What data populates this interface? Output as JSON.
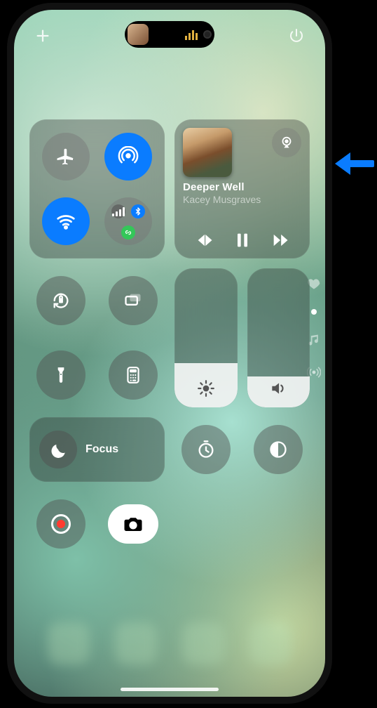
{
  "statusbar": {
    "add_label": "+",
    "power_label": "power"
  },
  "connectivity": {
    "airplane": {
      "name": "airplane-mode",
      "on": false,
      "color_off": "rgba(120,120,120,.45)",
      "color_on": "#ff9f0a"
    },
    "airdrop": {
      "name": "airdrop",
      "on": true,
      "color": "#0a7cff"
    },
    "wifi": {
      "name": "wifi",
      "on": true,
      "color": "#0a7cff"
    },
    "cluster": {
      "cellular_on": true,
      "bluetooth_on": true,
      "hotspot_on": true,
      "hotspot_color": "#34c759"
    }
  },
  "media": {
    "title": "Deeper Well",
    "artist": "Kacey Musgraves",
    "state": "paused",
    "airplay_available": true
  },
  "tiles": {
    "orientation_lock": "Orientation Lock",
    "screen_mirroring": "Screen Mirroring",
    "flashlight": "Flashlight",
    "calculator": "Calculator",
    "timer": "Timer",
    "dark_mode": "Dark Mode",
    "screen_record": "Screen Record",
    "camera": "Camera"
  },
  "focus": {
    "label": "Focus"
  },
  "sliders": {
    "brightness": {
      "value": 0.32
    },
    "volume": {
      "value": 0.22
    }
  },
  "rail": {
    "items": [
      "favorites",
      "music",
      "broadcast"
    ]
  }
}
